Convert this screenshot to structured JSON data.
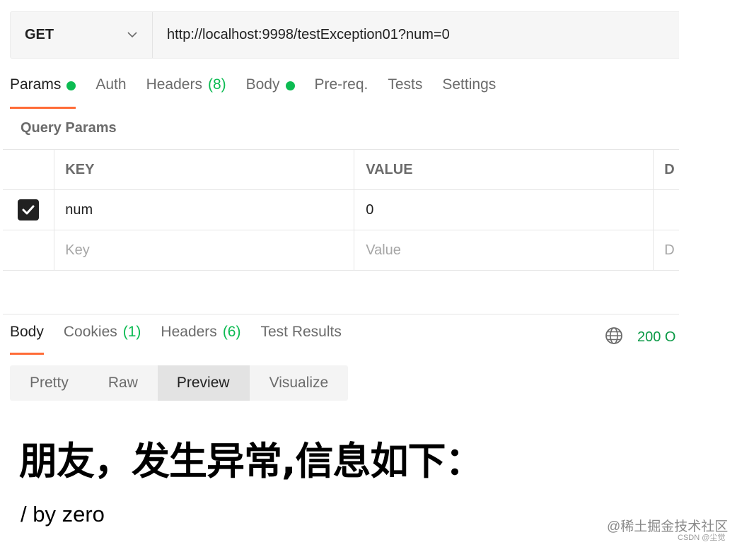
{
  "request": {
    "method": "GET",
    "url": "http://localhost:9998/testException01?num=0"
  },
  "request_tabs": [
    {
      "label": "Params",
      "dot": true,
      "active": true
    },
    {
      "label": "Auth"
    },
    {
      "label": "Headers",
      "count": "(8)"
    },
    {
      "label": "Body",
      "dot": true
    },
    {
      "label": "Pre-req."
    },
    {
      "label": "Tests"
    },
    {
      "label": "Settings"
    }
  ],
  "query_params": {
    "title": "Query Params",
    "columns": {
      "key": "KEY",
      "value": "VALUE",
      "desc": "D"
    },
    "rows": [
      {
        "checked": true,
        "key": "num",
        "value": "0"
      }
    ],
    "placeholder": {
      "key": "Key",
      "value": "Value",
      "desc": "D"
    }
  },
  "response_tabs": [
    {
      "label": "Body",
      "active": true
    },
    {
      "label": "Cookies",
      "count": "(1)"
    },
    {
      "label": "Headers",
      "count": "(6)"
    },
    {
      "label": "Test Results"
    }
  ],
  "status": {
    "code": "200 O"
  },
  "view_modes": [
    {
      "label": "Pretty"
    },
    {
      "label": "Raw"
    },
    {
      "label": "Preview",
      "active": true
    },
    {
      "label": "Visualize"
    }
  ],
  "preview": {
    "heading": "朋友，发生异常,信息如下：",
    "text": "/ by zero"
  },
  "watermark": {
    "line1": "@稀土掘金技术社区",
    "line2": "CSDN @尘觉"
  },
  "colors": {
    "accent": "#ff6c37",
    "green_dot": "#0cbb52",
    "status_green": "#0c9a47"
  },
  "icons": {
    "method_dropdown": "chevron-down-icon",
    "checkbox": "checkmark-icon",
    "network": "globe-icon"
  }
}
